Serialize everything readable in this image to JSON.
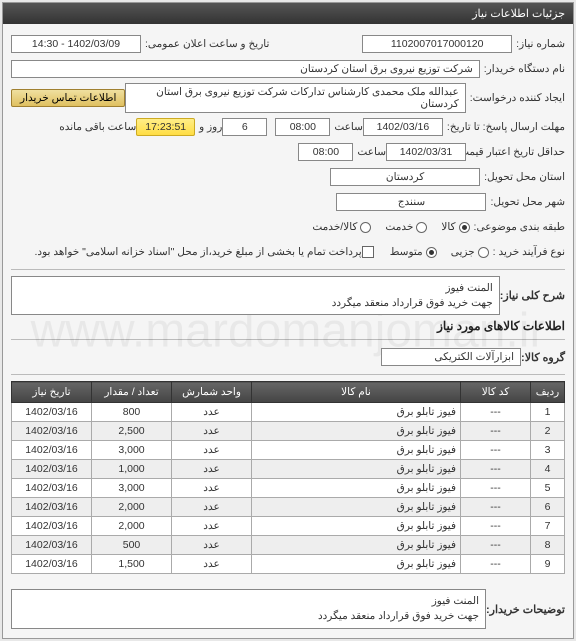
{
  "header": {
    "title": "جزئیات اطلاعات نیاز"
  },
  "form": {
    "need_no_label": "شماره نیاز:",
    "need_no": "1102007017000120",
    "ann_date_label": "تاریخ و ساعت اعلان عمومی:",
    "ann_date": "1402/03/09 - 14:30",
    "buyer_org_label": "نام دستگاه خریدار:",
    "buyer_org": "شرکت توزیع نیروی برق استان کردستان",
    "creator_label": "ایجاد کننده درخواست:",
    "creator": "عبدالله ملک محمدی کارشناس تدارکات شرکت توزیع نیروی برق استان کردستان",
    "contact_btn": "اطلاعات تماس خریدار",
    "deadline_label": "مهلت ارسال پاسخ: تا تاریخ:",
    "deadline_date": "1402/03/16",
    "time_label": "ساعت",
    "deadline_time": "08:00",
    "days_val": "6",
    "days_label": "روز و",
    "countdown": "17:23:51",
    "countdown_label": "ساعت باقی مانده",
    "price_valid_label": "حداقل تاریخ اعتبار قیمت تا تاریخ:",
    "price_valid_date": "1402/03/31",
    "price_valid_time": "08:00",
    "province_label": "استان محل تحویل:",
    "province": "کردستان",
    "city_label": "شهر محل تحویل:",
    "city": "سنندج",
    "topic_label": "طبقه بندی موضوعی:",
    "topic_goods": "کالا",
    "topic_service": "خدمت",
    "topic_both": "کالا/خدمت",
    "buy_type_label": "نوع فرآیند خرید :",
    "buy_small": "جزیی",
    "buy_med": "متوسط",
    "check_label": "پرداخت تمام یا بخشی از مبلغ خرید،از محل \"اسناد خزانه اسلامی\" خواهد بود."
  },
  "desc": {
    "main_label": "شرح کلی نیاز:",
    "main_text1": "المنت فیوز",
    "main_text2": "جهت خرید فوق قرارداد منعقد میگردد",
    "goods_title": "اطلاعات کالاهای مورد نیاز",
    "group_label": "گروه کالا:",
    "group": "ابزارآلات الکتریکی"
  },
  "table": {
    "h_row": "ردیف",
    "h_code": "کد کالا",
    "h_name": "نام کالا",
    "h_unit": "واحد شمارش",
    "h_qty": "تعداد / مقدار",
    "h_date": "تاریخ نیاز",
    "rows": [
      {
        "n": "1",
        "code": "---",
        "name": "فیوز تابلو برق",
        "unit": "عدد",
        "qty": "800",
        "date": "1402/03/16"
      },
      {
        "n": "2",
        "code": "---",
        "name": "فیوز تابلو برق",
        "unit": "عدد",
        "qty": "2,500",
        "date": "1402/03/16"
      },
      {
        "n": "3",
        "code": "---",
        "name": "فیوز تابلو برق",
        "unit": "عدد",
        "qty": "3,000",
        "date": "1402/03/16"
      },
      {
        "n": "4",
        "code": "---",
        "name": "فیوز تابلو برق",
        "unit": "عدد",
        "qty": "1,000",
        "date": "1402/03/16"
      },
      {
        "n": "5",
        "code": "---",
        "name": "فیوز تابلو برق",
        "unit": "عدد",
        "qty": "3,000",
        "date": "1402/03/16"
      },
      {
        "n": "6",
        "code": "---",
        "name": "فیوز تابلو برق",
        "unit": "عدد",
        "qty": "2,000",
        "date": "1402/03/16"
      },
      {
        "n": "7",
        "code": "---",
        "name": "فیوز تابلو برق",
        "unit": "عدد",
        "qty": "2,000",
        "date": "1402/03/16"
      },
      {
        "n": "8",
        "code": "---",
        "name": "فیوز تابلو برق",
        "unit": "عدد",
        "qty": "500",
        "date": "1402/03/16"
      },
      {
        "n": "9",
        "code": "---",
        "name": "فیوز تابلو برق",
        "unit": "عدد",
        "qty": "1,500",
        "date": "1402/03/16"
      }
    ]
  },
  "footer": {
    "notes_label": "توضیحات خریدار:",
    "notes1": "المنت فیوز",
    "notes2": "جهت خرید فوق قرارداد منعقد میگردد"
  }
}
